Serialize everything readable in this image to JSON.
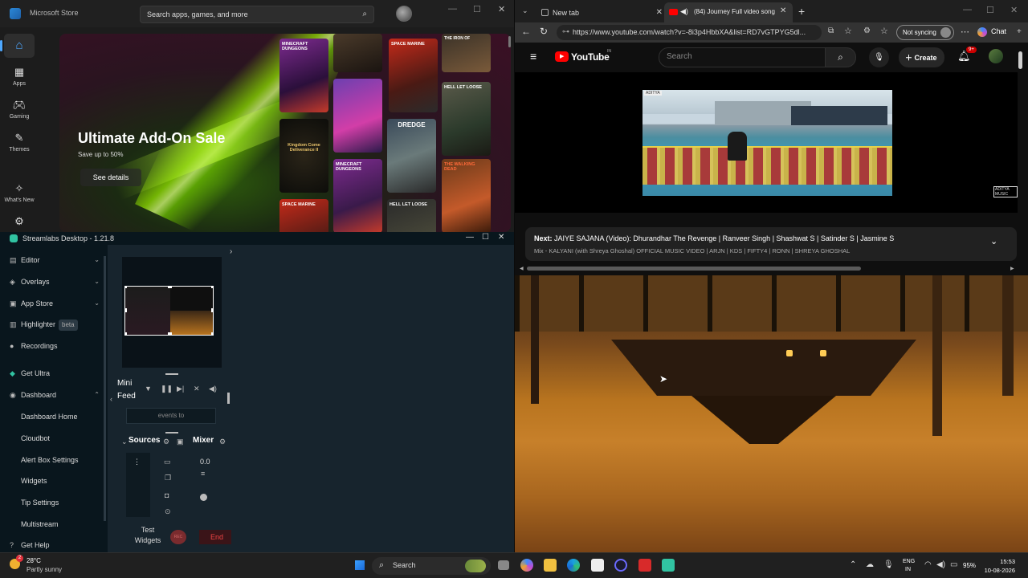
{
  "ms_store": {
    "title": "Microsoft Store",
    "search_placeholder": "Search apps, games, and more",
    "nav": [
      {
        "label": "Apps",
        "icon": "apps-icon"
      },
      {
        "label": "Gaming",
        "icon": "gaming-icon"
      },
      {
        "label": "Themes",
        "icon": "themes-icon"
      },
      {
        "label": "What's New",
        "icon": "whats-new-icon"
      }
    ],
    "hero": {
      "title": "Ultimate Add-On Sale",
      "subtitle": "Save up to 50%",
      "button": "See details",
      "tiles": [
        "MINECRAFT DUNGEONS",
        "SPACE MARINE",
        "Kingdom Come Deliverance II",
        "HELL LET LOOSE",
        "DREDGE",
        "MINECRAFT DUNGEONS",
        "SPACE MARINE",
        "HELL LET LOOSE",
        "THE WALKING DEAD",
        "THE IRON OF"
      ],
      "accent_glow": "#a4f000"
    }
  },
  "streamlabs": {
    "title": "Streamlabs Desktop - 1.21.8",
    "nav": [
      {
        "label": "Editor",
        "icon": "editor-icon",
        "chevron": "⌄"
      },
      {
        "label": "Overlays",
        "icon": "overlays-icon",
        "chevron": "⌄"
      },
      {
        "label": "App Store",
        "icon": "app-store-icon",
        "chevron": "⌄"
      },
      {
        "label": "Highlighter",
        "icon": "highlighter-icon",
        "badge": "beta"
      },
      {
        "label": "Recordings",
        "icon": "recordings-icon"
      },
      {
        "label": "Get Ultra",
        "icon": "ultra-icon"
      },
      {
        "label": "Dashboard",
        "icon": "dashboard-icon",
        "chevron": "⌃"
      }
    ],
    "dashboard_items": [
      "Dashboard Home",
      "Cloudbot",
      "Alert Box Settings",
      "Widgets",
      "Tip Settings",
      "Multistream"
    ],
    "get_help": "Get Help",
    "mini_feed": "Mini Feed",
    "feed_text": "events to",
    "sources": "Sources",
    "mixer": "Mixer",
    "mixer_value": "0.0",
    "test_widgets": "Test Widgets",
    "rec_label": "REC",
    "end_label": "End",
    "accent": "#31c3a2"
  },
  "browser": {
    "tab1": "New tab",
    "tab2": "(84) Journey Full video song",
    "url": "https://www.youtube.com/watch?v=-8i3p4HbbXA&list=RD7vGTPYG5dl...",
    "sync": "Not syncing",
    "chat": "Chat",
    "youtube": {
      "logo": "YouTube",
      "region": "IN",
      "search_placeholder": "Search",
      "create": "Create",
      "notif_count": "9+",
      "video_watermark": "ADITYA MUSIC",
      "channel_badge": "ADITYA",
      "next_prefix": "Next:",
      "next_title": "JAIYE SAJANA (Video): Dhurandhar The Revenge | Ranveer Singh | Shashwat S | Satinder S | Jasmine S",
      "next_sub": "Mix - KALYANI (with Shreya Ghoshal) OFFICIAL MUSIC VIDEO | ARJN | KDS | FIFTY4 | RONN | SHREYA GHOSHAL",
      "brand_red": "#ff0000"
    }
  },
  "taskbar": {
    "temp": "28°C",
    "condition": "Partly sunny",
    "search": "Search",
    "lang1": "ENG",
    "lang2": "IN",
    "battery": "95%",
    "time": "15:53",
    "date": "10-08-2026",
    "notif_badge": "2"
  }
}
